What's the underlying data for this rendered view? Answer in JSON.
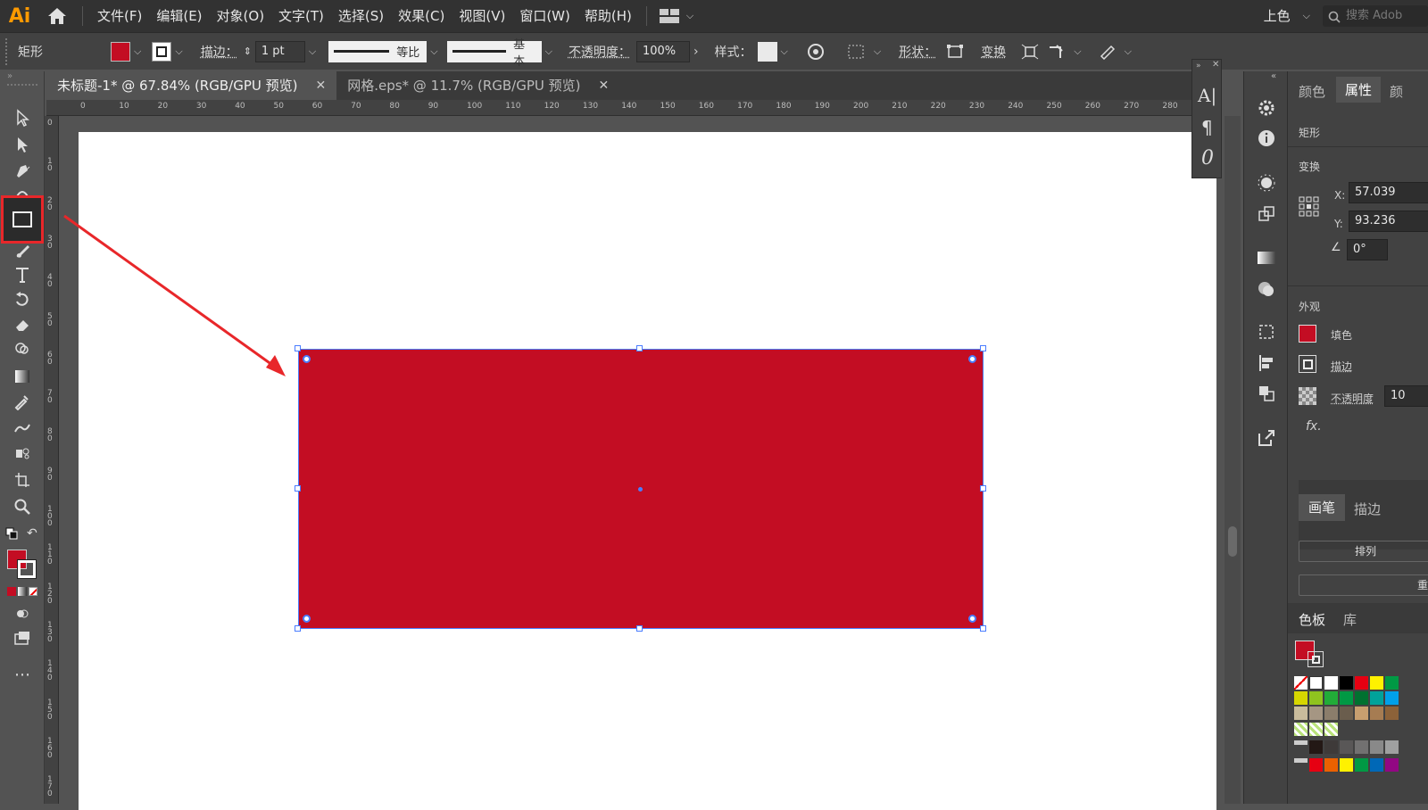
{
  "app": {
    "logo": "Ai"
  },
  "menu": [
    "文件(F)",
    "编辑(E)",
    "对象(O)",
    "文字(T)",
    "选择(S)",
    "效果(C)",
    "视图(V)",
    "窗口(W)",
    "帮助(H)"
  ],
  "workspace": {
    "label": "上色",
    "search_placeholder": "搜索 Adob"
  },
  "control_bar": {
    "object_label": "矩形",
    "stroke_label": "描边：",
    "stroke_weight": "1 pt",
    "profile_label": "等比",
    "brush_label": "基本",
    "opacity_label": "不透明度：",
    "opacity_value": "100%",
    "style_label": "样式：",
    "shape_label": "形状：",
    "transform_label": "变换"
  },
  "tabs": [
    {
      "label": "未标题-1* @ 67.84% (RGB/GPU 预览)",
      "active": true
    },
    {
      "label": "网格.eps* @ 11.7% (RGB/GPU 预览)",
      "active": false
    }
  ],
  "ruler_top": [
    "0",
    "10",
    "20",
    "30",
    "40",
    "50",
    "60",
    "70",
    "80",
    "90",
    "100",
    "110",
    "120",
    "130",
    "140",
    "150",
    "160",
    "170",
    "180",
    "190",
    "200",
    "210",
    "220",
    "230",
    "240",
    "250",
    "260",
    "270",
    "280"
  ],
  "ruler_left": [
    "0",
    "1 0",
    "2 0",
    "3 0",
    "4 0",
    "5 0",
    "6 0",
    "7 0",
    "8 0",
    "9 0",
    "1 0 0",
    "1 1 0",
    "1 2 0",
    "1 3 0",
    "1 4 0",
    "1 5 0",
    "1 6 0",
    "1 7 0"
  ],
  "colors": {
    "fill": "#c30d23",
    "selection": "#4a7dff",
    "annotation": "#e8272a"
  },
  "properties": {
    "tabs": [
      "颜色",
      "属性",
      "颜"
    ],
    "object_type": "矩形",
    "transform_title": "变换",
    "x_label": "X:",
    "x_value": "57.039",
    "y_label": "Y:",
    "y_value": "93.236",
    "angle_value": "0°",
    "appearance_title": "外观",
    "fill_label": "填色",
    "stroke_label": "描边",
    "opacity_label": "不透明度",
    "opacity_value": "10",
    "fx_label": "fx.",
    "sub_tabs": [
      "画笔",
      "描边"
    ],
    "arrange_button": "排列",
    "re_button": "重",
    "swatch_tabs": [
      "色板",
      "库"
    ]
  }
}
